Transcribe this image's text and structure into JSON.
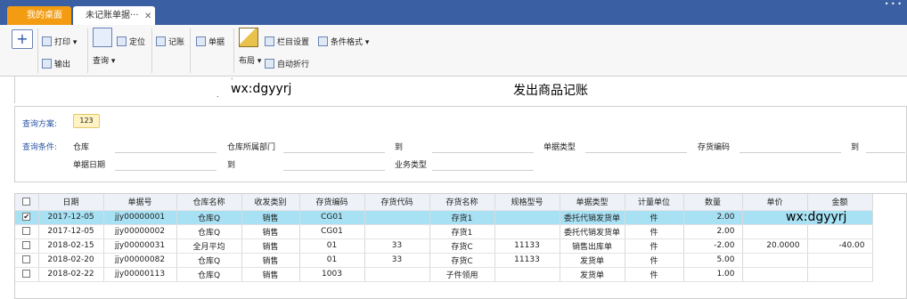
{
  "tabs": {
    "home": "我的桌面",
    "active": "未记账单据···",
    "close": "✕",
    "dots": "• • •"
  },
  "toolbar": {
    "add": "+",
    "print": "打印",
    "export": "输出",
    "query": "查询",
    "locate": "定位",
    "post": "记账",
    "document": "单据",
    "layout": "布局",
    "column_settings": "栏目设置",
    "conditional_format": "条件格式",
    "auto_wrap": "自动折行"
  },
  "header": {
    "watermark": "wx:dgyyrj",
    "title": "发出商品记账",
    "dot": "."
  },
  "query": {
    "scheme_label": "查询方案:",
    "scheme_value": "123",
    "condition_label": "查询条件:",
    "warehouse": "仓库",
    "warehouse_dept": "仓库所属部门",
    "to": "到",
    "doc_type": "单据类型",
    "inv_code": "存货编码",
    "doc_date": "单据日期",
    "biz_type": "业务类型"
  },
  "grid": {
    "columns": [
      "日期",
      "单据号",
      "仓库名称",
      "收发类别",
      "存货编码",
      "存货代码",
      "存货名称",
      "规格型号",
      "单据类型",
      "计量单位",
      "数量",
      "单价",
      "金额"
    ],
    "rows": [
      {
        "checked": true,
        "cells": [
          "2017-12-05",
          "jjy00000001",
          "仓库Q",
          "销售",
          "CG01",
          "",
          "存货1",
          "",
          "委托代销发货单",
          "件",
          "2.00",
          "",
          ""
        ]
      },
      {
        "checked": false,
        "cells": [
          "2017-12-05",
          "jjy00000002",
          "仓库Q",
          "销售",
          "CG01",
          "",
          "存货1",
          "",
          "委托代销发货单",
          "件",
          "2.00",
          "",
          ""
        ]
      },
      {
        "checked": false,
        "cells": [
          "2018-02-15",
          "jjy00000031",
          "全月平均",
          "销售",
          "01",
          "33",
          "存货C",
          "11133",
          "销售出库单",
          "件",
          "-2.00",
          "20.0000",
          "-40.00"
        ]
      },
      {
        "checked": false,
        "cells": [
          "2018-02-20",
          "jjy00000082",
          "仓库Q",
          "销售",
          "01",
          "33",
          "存货C",
          "11133",
          "发货单",
          "件",
          "5.00",
          "",
          ""
        ]
      },
      {
        "checked": false,
        "cells": [
          "2018-02-22",
          "jjy00000113",
          "仓库Q",
          "销售",
          "1003",
          "",
          "子件领用",
          "",
          "发货单",
          "件",
          "1.00",
          "",
          ""
        ]
      }
    ]
  }
}
